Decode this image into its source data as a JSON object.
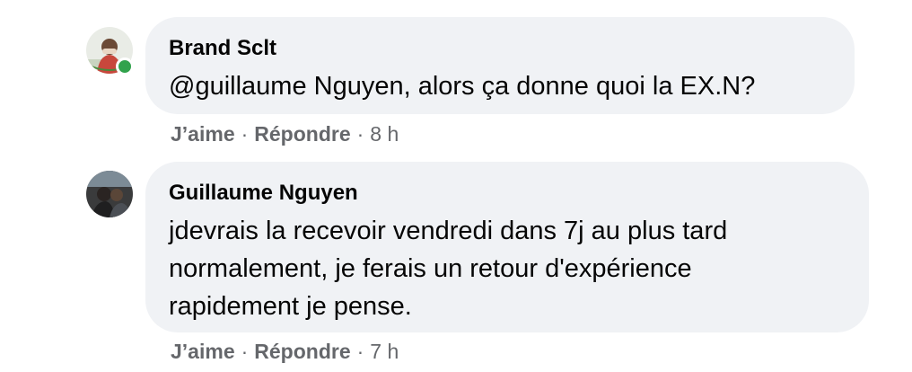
{
  "comments": [
    {
      "author": "Brand Sclt",
      "text": "@guillaume Nguyen, alors ça donne quoi la EX.N?",
      "like_label": "J’aime",
      "reply_label": "Répondre",
      "separator": "·",
      "time": "8 h",
      "online": true
    },
    {
      "author": "Guillaume Nguyen",
      "text": "jdevrais la recevoir vendredi dans 7j au plus tard normalement, je ferais un retour d'expérience rapidement je pense.",
      "like_label": "J’aime",
      "reply_label": "Répondre",
      "separator": "·",
      "time": "7 h",
      "online": false
    }
  ],
  "colors": {
    "bubble_bg": "#f0f2f5",
    "meta_text": "#65676b",
    "online_dot": "#31a24c"
  }
}
